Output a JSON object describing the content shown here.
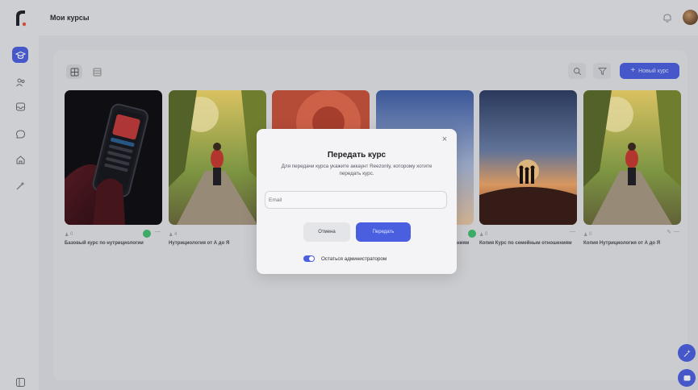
{
  "header": {
    "title": "Мои курсы"
  },
  "toolbar": {
    "new_course_label": "Новый курс"
  },
  "cards": [
    {
      "stat": "0",
      "title": "Базовый курс по нутрициологии"
    },
    {
      "stat": "4",
      "title": "Нутрициология от А до Я"
    },
    {
      "stat": "",
      "title": ""
    },
    {
      "stat": "",
      "title": ""
    },
    {
      "stat": "0",
      "title": "Копия Курс по семейным отношениям"
    },
    {
      "stat": "0",
      "title": "Копия Нутрициология от А до Я"
    }
  ],
  "card4_partial_title": "ниям",
  "modal": {
    "close": "×",
    "title": "Передать курс",
    "description": "Для передачи курса укажите аккаунт Reezonly, которому хотите передать курс.",
    "email_placeholder": "Email",
    "cancel_label": "Отмена",
    "submit_label": "Передать",
    "stay_admin_label": "Остаться администратором"
  },
  "colors": {
    "accent": "#4a5fe0",
    "badge": "#3fbf6e"
  }
}
